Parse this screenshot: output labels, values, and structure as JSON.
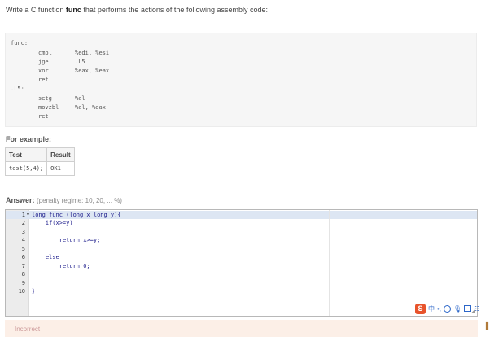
{
  "question": {
    "prefix": "Write a C function ",
    "keyword": "func",
    "suffix": " that performs the actions of the following assembly code:"
  },
  "assembly": [
    {
      "label": "func:",
      "instr": "",
      "operands": ""
    },
    {
      "label": "",
      "instr": "cmpl",
      "operands": "%edi, %esi"
    },
    {
      "label": "",
      "instr": "jge",
      "operands": ".L5"
    },
    {
      "label": "",
      "instr": "xorl",
      "operands": "%eax, %eax"
    },
    {
      "label": "",
      "instr": "ret",
      "operands": ""
    },
    {
      "label": ".L5:",
      "instr": "",
      "operands": ""
    },
    {
      "label": "",
      "instr": "setg",
      "operands": "%al"
    },
    {
      "label": "",
      "instr": "movzbl",
      "operands": "%al, %eax"
    },
    {
      "label": "",
      "instr": "ret",
      "operands": ""
    }
  ],
  "example": {
    "label": "For example:",
    "headers": [
      "Test",
      "Result"
    ],
    "rows": [
      [
        "test(5,4);",
        "OK1"
      ]
    ]
  },
  "answer": {
    "label": "Answer:",
    "penalty": "(penalty regime: 10, 20, ... %)"
  },
  "editor": {
    "lines": [
      {
        "no": "1",
        "code": "long func (long x long y){"
      },
      {
        "no": "2",
        "code": "    if(x>=y)"
      },
      {
        "no": "3",
        "code": ""
      },
      {
        "no": "4",
        "code": "        return x>=y;"
      },
      {
        "no": "5",
        "code": ""
      },
      {
        "no": "6",
        "code": "    else"
      },
      {
        "no": "7",
        "code": "        return 0;"
      },
      {
        "no": "8",
        "code": ""
      },
      {
        "no": "9",
        "code": ""
      },
      {
        "no": "10",
        "code": "}"
      }
    ]
  },
  "ime": {
    "logo": "S",
    "lang": "中",
    "punct": "•,"
  },
  "result": {
    "status": "Incorrect"
  }
}
